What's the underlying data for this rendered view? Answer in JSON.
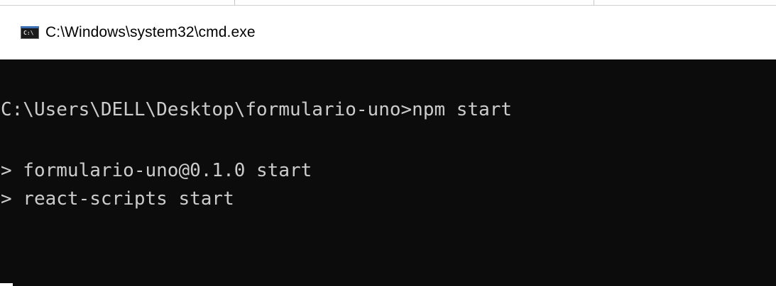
{
  "window": {
    "title": "C:\\Windows\\system32\\cmd.exe",
    "icon": "console-icon",
    "icon_glyph": "C:\\"
  },
  "console": {
    "lines": [
      "C:\\Users\\DELL\\Desktop\\formulario-uno>npm start",
      "> formulario-uno@0.1.0 start",
      "> react-scripts start"
    ]
  },
  "colors": {
    "background": "#0c0c0c",
    "text": "#cccccc",
    "titlebar": "#ffffff"
  }
}
